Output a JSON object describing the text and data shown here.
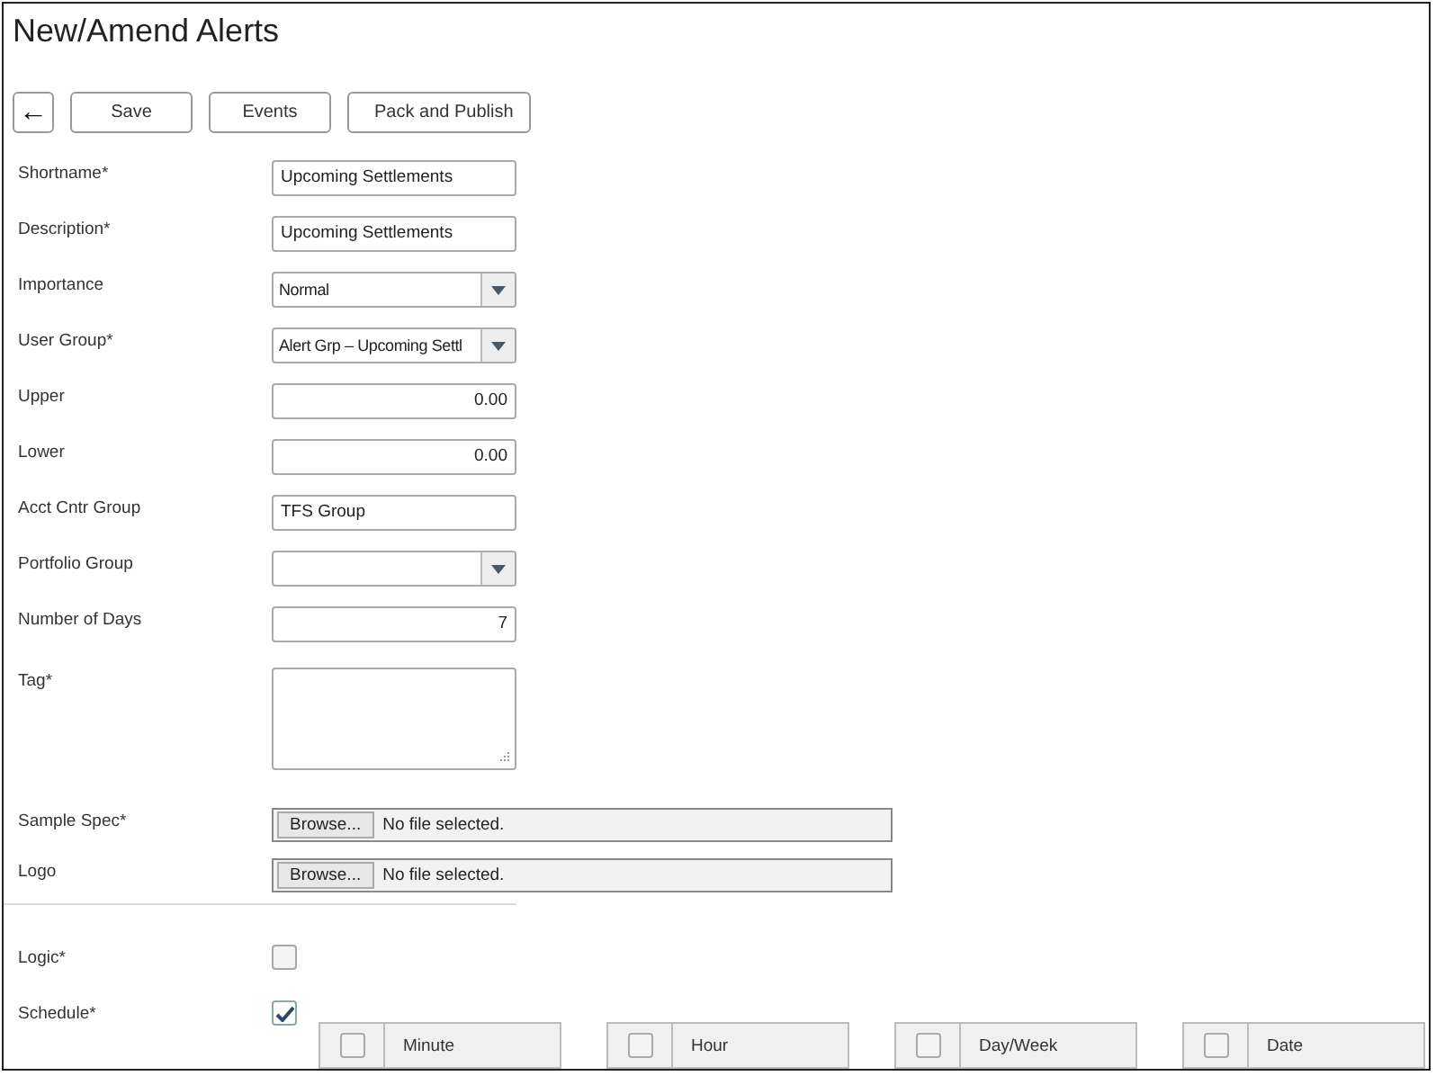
{
  "page": {
    "title": "New/Amend Alerts"
  },
  "toolbar": {
    "back": "←",
    "buttons": [
      "Save",
      "Events",
      "Pack and Publish"
    ]
  },
  "fields": [
    {
      "kind": "text",
      "label": "Shortname*",
      "value": "Upcoming Settlements"
    },
    {
      "kind": "text",
      "label": "Description*",
      "value": "Upcoming Settlements"
    },
    {
      "kind": "select",
      "label": "Importance",
      "value": "Normal"
    },
    {
      "kind": "select",
      "label": "User Group*",
      "value": "Alert Grp – Upcoming Settl"
    },
    {
      "kind": "number",
      "label": "Upper",
      "value": "0.00"
    },
    {
      "kind": "number",
      "label": "Lower",
      "value": "0.00"
    },
    {
      "kind": "text",
      "label": "Acct Cntr Group",
      "value": "TFS Group"
    },
    {
      "kind": "select",
      "label": "Portfolio Group"
    },
    {
      "kind": "number",
      "label": "Number of Days",
      "value": "7"
    },
    {
      "kind": "textarea",
      "label": "Tag*"
    },
    {
      "kind": "file",
      "label": "Sample Spec*",
      "button": "Browse...",
      "value": "No file selected."
    },
    {
      "kind": "file",
      "label": "Logo",
      "button": "Browse...",
      "value": "No file selected."
    },
    {
      "kind": "divider"
    },
    {
      "kind": "checkbox",
      "label": "Logic*",
      "checked": false
    },
    {
      "kind": "checkbox",
      "label": "Schedule*",
      "checked": true
    }
  ],
  "schedule_options": [
    {
      "label": "Minute",
      "checked": false
    },
    {
      "label": "Hour",
      "checked": false
    },
    {
      "label": "Day/Week",
      "checked": false
    },
    {
      "label": "Date",
      "checked": false
    }
  ]
}
